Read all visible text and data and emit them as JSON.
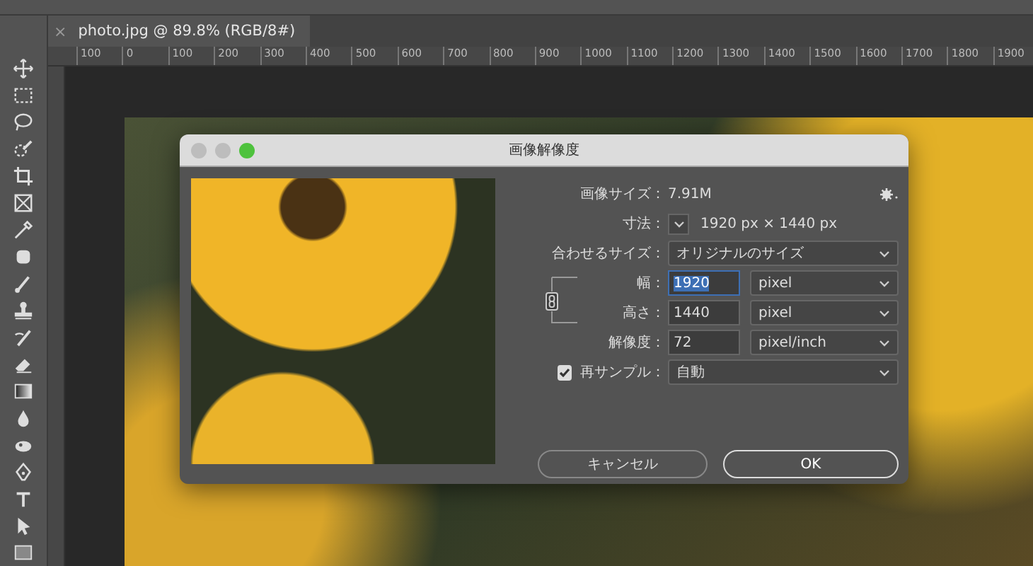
{
  "document_tab": {
    "close": "×",
    "title": "photo.jpg @ 89.8% (RGB/8#)"
  },
  "ruler": {
    "labels": [
      "100",
      "0",
      "100",
      "200",
      "300",
      "400",
      "500",
      "600",
      "700",
      "800",
      "900",
      "1000",
      "1100",
      "1200",
      "1300",
      "1400",
      "1500",
      "1600",
      "1700",
      "1800",
      "1900"
    ]
  },
  "dialog": {
    "title": "画像解像度",
    "image_size": {
      "label": "画像サイズ：",
      "value": "7.91M"
    },
    "dimensions": {
      "label": "寸法：",
      "value": "1920 px × 1440 px"
    },
    "fit_to": {
      "label": "合わせるサイズ：",
      "value": "オリジナルのサイズ"
    },
    "constrain_proportions": true,
    "fields": [
      {
        "label": "幅：",
        "value": "1920",
        "unit": "pixel",
        "selected": true
      },
      {
        "label": "高さ：",
        "value": "1440",
        "unit": "pixel",
        "selected": false
      },
      {
        "label": "解像度：",
        "value": "72",
        "unit": "pixel/inch",
        "selected": false
      }
    ],
    "resample": {
      "label": "再サンプル：",
      "checked": true,
      "value": "自動"
    },
    "buttons": [
      {
        "label": "キャンセル",
        "default": false
      },
      {
        "label": "OK",
        "default": true
      }
    ]
  }
}
